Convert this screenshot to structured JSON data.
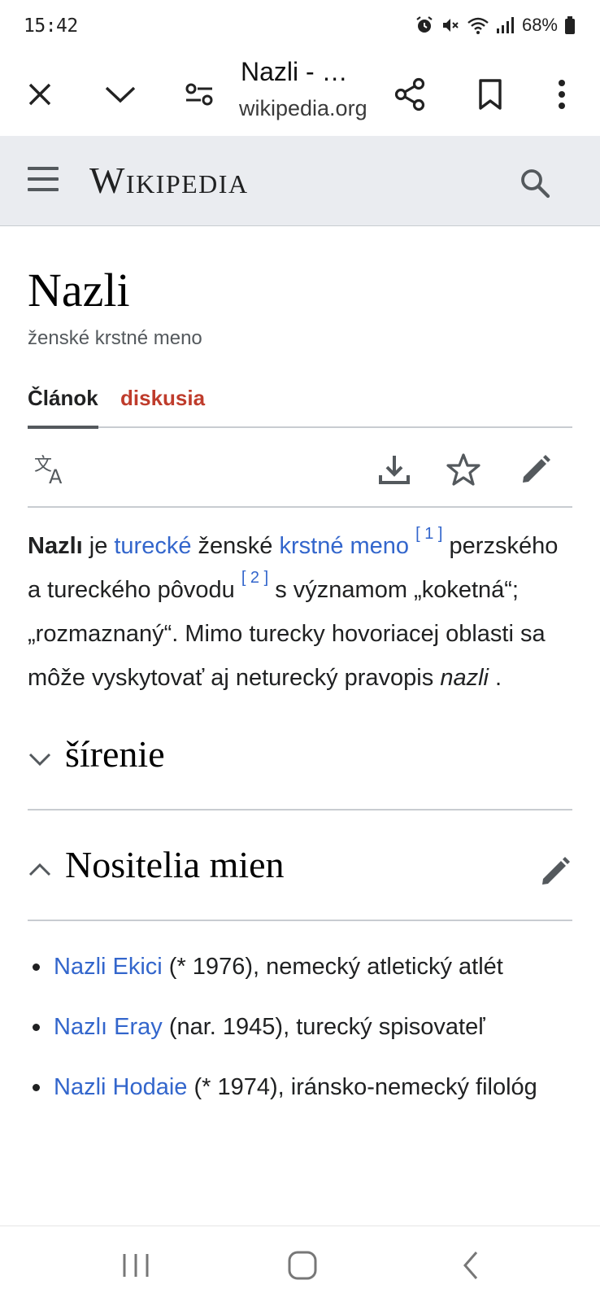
{
  "status_bar": {
    "time": "15:42",
    "battery": "68%",
    "icons": [
      "alarm-icon",
      "mute-icon",
      "wifi-icon",
      "signal-icon",
      "battery-icon"
    ]
  },
  "browser": {
    "title": "Nazli - …",
    "url": "wikipedia.org",
    "buttons": [
      "close-icon",
      "chevron-down-icon",
      "site-settings-icon",
      "share-icon",
      "bookmark-icon",
      "more-icon"
    ]
  },
  "wiki": {
    "logo": "Wikipedia",
    "page_title": "Nazli",
    "subtitle": "ženské krstné meno",
    "tabs": {
      "article": "Článok",
      "talk": "diskusia"
    },
    "intro": {
      "bold": "Nazlı",
      "t1": " je ",
      "link1": "turecké",
      "t2": " ženské ",
      "link2": "krstné meno",
      "ref1": "[ 1 ]",
      "t3": " perzského a tureckého pôvodu ",
      "ref2": "[ 2 ]",
      "t4": " s významom „koketná“; „rozmaznaný“. Mimo turecky hovoriacej oblasti sa môže vyskytovať aj neturecký pravopis ",
      "italic": "nazli",
      "t5": " ."
    },
    "sections": {
      "first": "šírenie",
      "second": "Nositelia mien"
    },
    "people": [
      {
        "name": "Nazli Ekici",
        "desc": " (* 1976), nemecký atletický atlét"
      },
      {
        "name": "Nazlı Eray",
        "desc": " (nar. 1945), turecký spisovateľ"
      },
      {
        "name": "Nazli Hodaie",
        "desc": " (* 1974), iránsko-nemecký filológ"
      }
    ]
  },
  "colors": {
    "link": "#3366cc",
    "talk_tab": "#bf3c2c",
    "header_bg": "#eaecf0"
  }
}
